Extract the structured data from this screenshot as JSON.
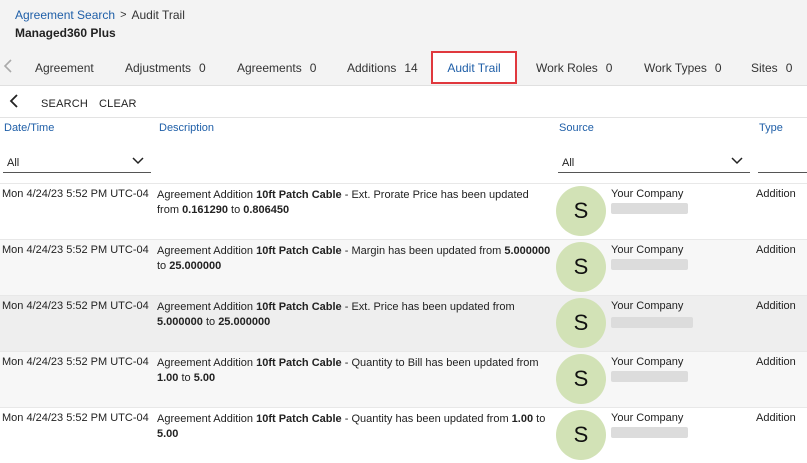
{
  "breadcrumb": {
    "parent": "Agreement Search",
    "separator": ">",
    "current": "Audit Trail"
  },
  "page_title": "Managed360 Plus",
  "tabs": [
    {
      "label": "Agreement",
      "count": ""
    },
    {
      "label": "Adjustments",
      "count": "0"
    },
    {
      "label": "Agreements",
      "count": "0"
    },
    {
      "label": "Additions",
      "count": "14"
    },
    {
      "label": "Audit Trail",
      "count": ""
    },
    {
      "label": "Work Roles",
      "count": "0"
    },
    {
      "label": "Work Types",
      "count": "0"
    },
    {
      "label": "Sites",
      "count": "0"
    }
  ],
  "active_tab": "Audit Trail",
  "toolbar": {
    "search_label": "SEARCH",
    "clear_label": "CLEAR"
  },
  "columns": {
    "date": "Date/Time",
    "description": "Description",
    "source": "Source",
    "type": "Type"
  },
  "filters": {
    "date": "All",
    "source": "All"
  },
  "rows": [
    {
      "date": "Mon 4/24/23 5:52 PM UTC-04",
      "desc_prefix": "Agreement Addition ",
      "desc_item": "10ft Patch Cable",
      "desc_mid": " - Ext. Prorate Price has been updated from ",
      "from": "0.161290",
      "to_word": " to ",
      "to": "0.806450",
      "avatar": "S",
      "source": "Your Company",
      "type": "Addition"
    },
    {
      "date": "Mon 4/24/23 5:52 PM UTC-04",
      "desc_prefix": "Agreement Addition ",
      "desc_item": "10ft Patch Cable",
      "desc_mid": " - Margin has been updated from ",
      "from": "5.000000",
      "to_word": " to ",
      "to": "25.000000",
      "avatar": "S",
      "source": "Your Company",
      "type": "Addition"
    },
    {
      "date": "Mon 4/24/23 5:52 PM UTC-04",
      "desc_prefix": "Agreement Addition ",
      "desc_item": "10ft Patch Cable",
      "desc_mid": " - Ext. Price has been updated from ",
      "from": "5.000000",
      "to_word": " to ",
      "to": "25.000000",
      "avatar": "S",
      "source": "Your Company",
      "type": "Addition"
    },
    {
      "date": "Mon 4/24/23 5:52 PM UTC-04",
      "desc_prefix": "Agreement Addition ",
      "desc_item": "10ft Patch Cable",
      "desc_mid": " - Quantity to Bill has been updated from ",
      "from": "1.00",
      "to_word": " to ",
      "to": "5.00",
      "avatar": "S",
      "source": "Your Company",
      "type": "Addition"
    },
    {
      "date": "Mon 4/24/23 5:52 PM UTC-04",
      "desc_prefix": "Agreement Addition ",
      "desc_item": "10ft Patch Cable",
      "desc_mid": " - Quantity has been updated from ",
      "from": "1.00",
      "to_word": " to ",
      "to": "5.00",
      "avatar": "S",
      "source": "Your Company",
      "type": "Addition"
    }
  ],
  "icons": {
    "tab_scroll_left": "chevron-left-icon",
    "back": "chevron-left-icon",
    "dropdown": "chevron-down-icon"
  },
  "colors": {
    "link": "#1f5fa8",
    "active_tab_border": "#e0383e",
    "avatar_bg": "#d2e2b6"
  }
}
